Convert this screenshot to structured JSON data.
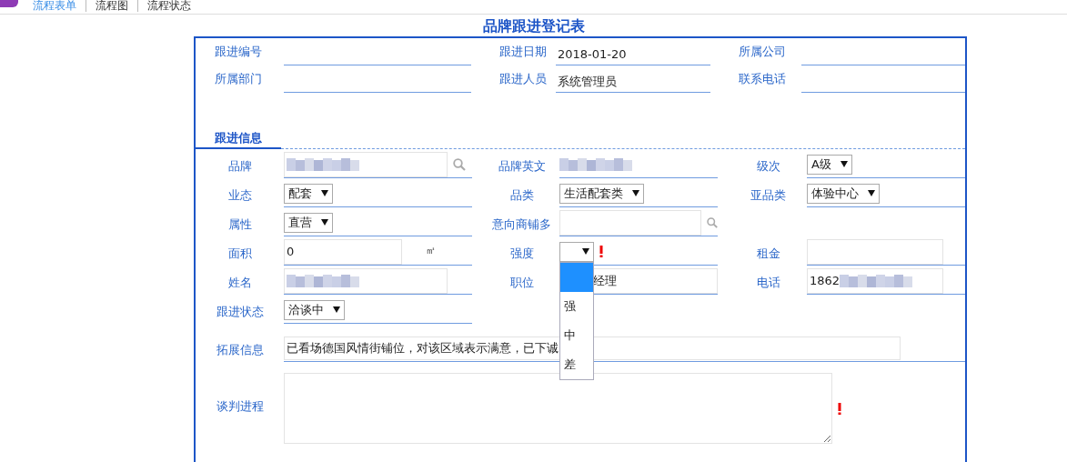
{
  "tabs": [
    {
      "label": "流程表单",
      "selected": true
    },
    {
      "label": "流程图",
      "selected": false
    },
    {
      "label": "流程状态",
      "selected": false
    }
  ],
  "title": "品牌跟进登记表",
  "header_fields": [
    {
      "label": "跟进编号"
    },
    {
      "label": "跟进日期",
      "value": "2018-01-20"
    },
    {
      "label": "所属公司"
    },
    {
      "label": "所属部门"
    },
    {
      "label": "跟进人员",
      "value": "系统管理员"
    },
    {
      "label": "联系电话"
    }
  ],
  "section_title": "跟进信息",
  "rows": [
    [
      {
        "label": "品牌",
        "kind": "search",
        "redacted": true
      },
      {
        "label": "品牌英文",
        "kind": "plain",
        "redacted": true
      },
      {
        "label": "级次",
        "kind": "select",
        "value": "A级"
      }
    ],
    [
      {
        "label": "业态",
        "kind": "select",
        "value": "配套"
      },
      {
        "label": "品类",
        "kind": "select",
        "value": "生活配套类"
      },
      {
        "label": "亚品类",
        "kind": "select",
        "value": "体验中心"
      }
    ],
    [
      {
        "label": "属性",
        "kind": "select",
        "value": "直营"
      },
      {
        "label": "意向商铺多",
        "kind": "search"
      }
    ],
    [
      {
        "label": "面积",
        "kind": "input",
        "value": "0",
        "unit": "㎡"
      },
      {
        "label": "强度",
        "kind": "select",
        "required": true,
        "expanded": true,
        "options": [
          {
            "selected": true
          },
          {
            "label": "强",
            "selected": false
          },
          {
            "label": "中",
            "selected": false
          },
          {
            "label": "差",
            "selected": false
          }
        ]
      },
      {
        "label": "租金",
        "kind": "input"
      }
    ],
    [
      {
        "label": "姓名",
        "kind": "input",
        "redacted": true
      },
      {
        "label": "职位",
        "kind": "input",
        "value": "经理"
      },
      {
        "label": "电话",
        "kind": "input",
        "value": "1862",
        "redacted": true
      }
    ],
    [
      {
        "label": "跟进状态",
        "kind": "select",
        "value": "洽谈中"
      }
    ],
    [
      {
        "label": "拓展信息",
        "kind": "longtext",
        "value": "已看场德国风情街铺位，对该区域表示满意，已下诚"
      }
    ],
    [
      {
        "label": "谈判进程",
        "kind": "textarea",
        "required": true
      }
    ]
  ]
}
